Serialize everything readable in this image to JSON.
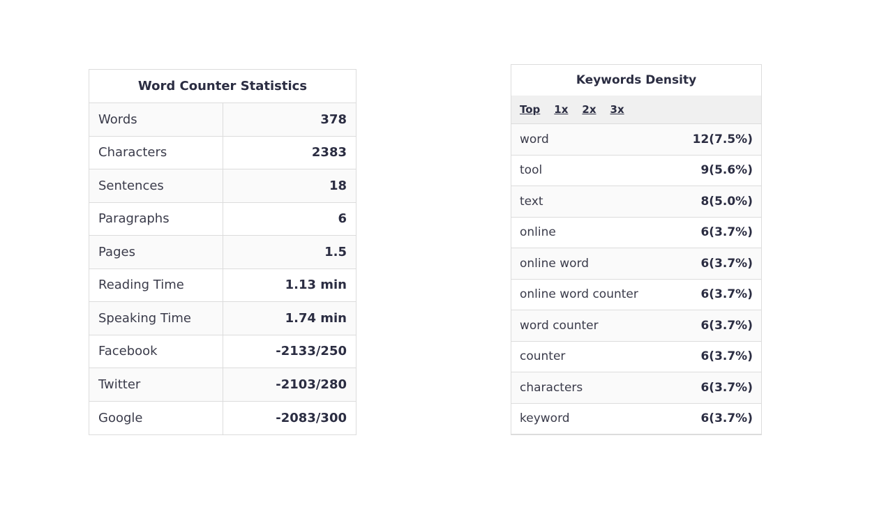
{
  "stats": {
    "title": "Word Counter Statistics",
    "rows": [
      {
        "label": "Words",
        "value": "378"
      },
      {
        "label": "Characters",
        "value": "2383"
      },
      {
        "label": "Sentences",
        "value": "18"
      },
      {
        "label": "Paragraphs",
        "value": "6"
      },
      {
        "label": "Pages",
        "value": "1.5"
      },
      {
        "label": "Reading Time",
        "value": "1.13 min"
      },
      {
        "label": "Speaking Time",
        "value": "1.74 min"
      },
      {
        "label": "Facebook",
        "value": "-2133/250"
      },
      {
        "label": "Twitter",
        "value": "-2103/280"
      },
      {
        "label": "Google",
        "value": "-2083/300"
      }
    ]
  },
  "keywords": {
    "title": "Keywords Density",
    "filters": [
      "Top",
      "1x",
      "2x",
      "3x"
    ],
    "rows": [
      {
        "word": "word",
        "count": "12(7.5%)"
      },
      {
        "word": "tool",
        "count": "9(5.6%)"
      },
      {
        "word": "text",
        "count": "8(5.0%)"
      },
      {
        "word": "online",
        "count": "6(3.7%)"
      },
      {
        "word": "online word",
        "count": "6(3.7%)"
      },
      {
        "word": "online word counter",
        "count": "6(3.7%)"
      },
      {
        "word": "word counter",
        "count": "6(3.7%)"
      },
      {
        "word": "counter",
        "count": "6(3.7%)"
      },
      {
        "word": "characters",
        "count": "6(3.7%)"
      },
      {
        "word": "keyword",
        "count": "6(3.7%)"
      }
    ]
  }
}
